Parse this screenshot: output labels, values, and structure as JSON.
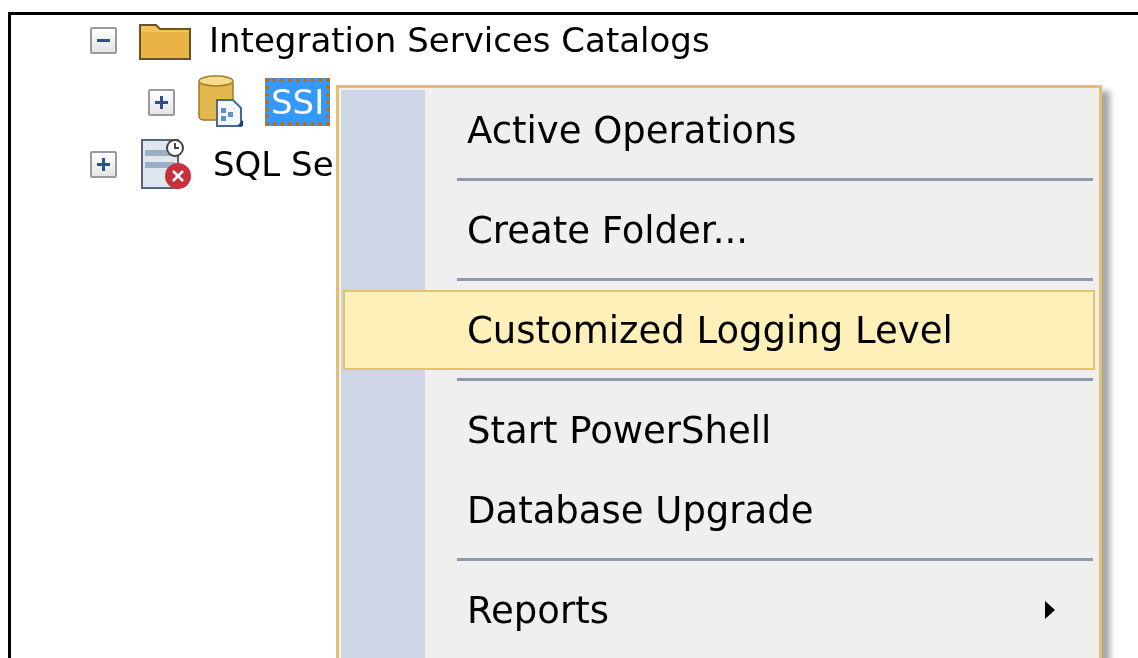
{
  "tree": [
    {
      "label": "Integration Services Catalogs",
      "kind": "folder",
      "expanded": true,
      "selected": false,
      "children": [
        {
          "label": "SSI",
          "kind": "catalog",
          "expanded": false,
          "selected": true
        }
      ]
    },
    {
      "label": "SQL Se",
      "kind": "agent",
      "expanded": false,
      "selected": false
    }
  ],
  "context_menu": {
    "items": [
      {
        "kind": "item",
        "label": "Active Operations",
        "selected": false,
        "submenu": false
      },
      {
        "kind": "separator"
      },
      {
        "kind": "item",
        "label": "Create Folder...",
        "selected": false,
        "submenu": false
      },
      {
        "kind": "separator"
      },
      {
        "kind": "item",
        "label": "Customized Logging Level",
        "selected": true,
        "submenu": false
      },
      {
        "kind": "separator"
      },
      {
        "kind": "item",
        "label": "Start PowerShell",
        "selected": false,
        "submenu": false
      },
      {
        "kind": "item",
        "label": "Database Upgrade",
        "selected": false,
        "submenu": false
      },
      {
        "kind": "separator"
      },
      {
        "kind": "item",
        "label": "Reports",
        "selected": false,
        "submenu": true
      }
    ]
  }
}
